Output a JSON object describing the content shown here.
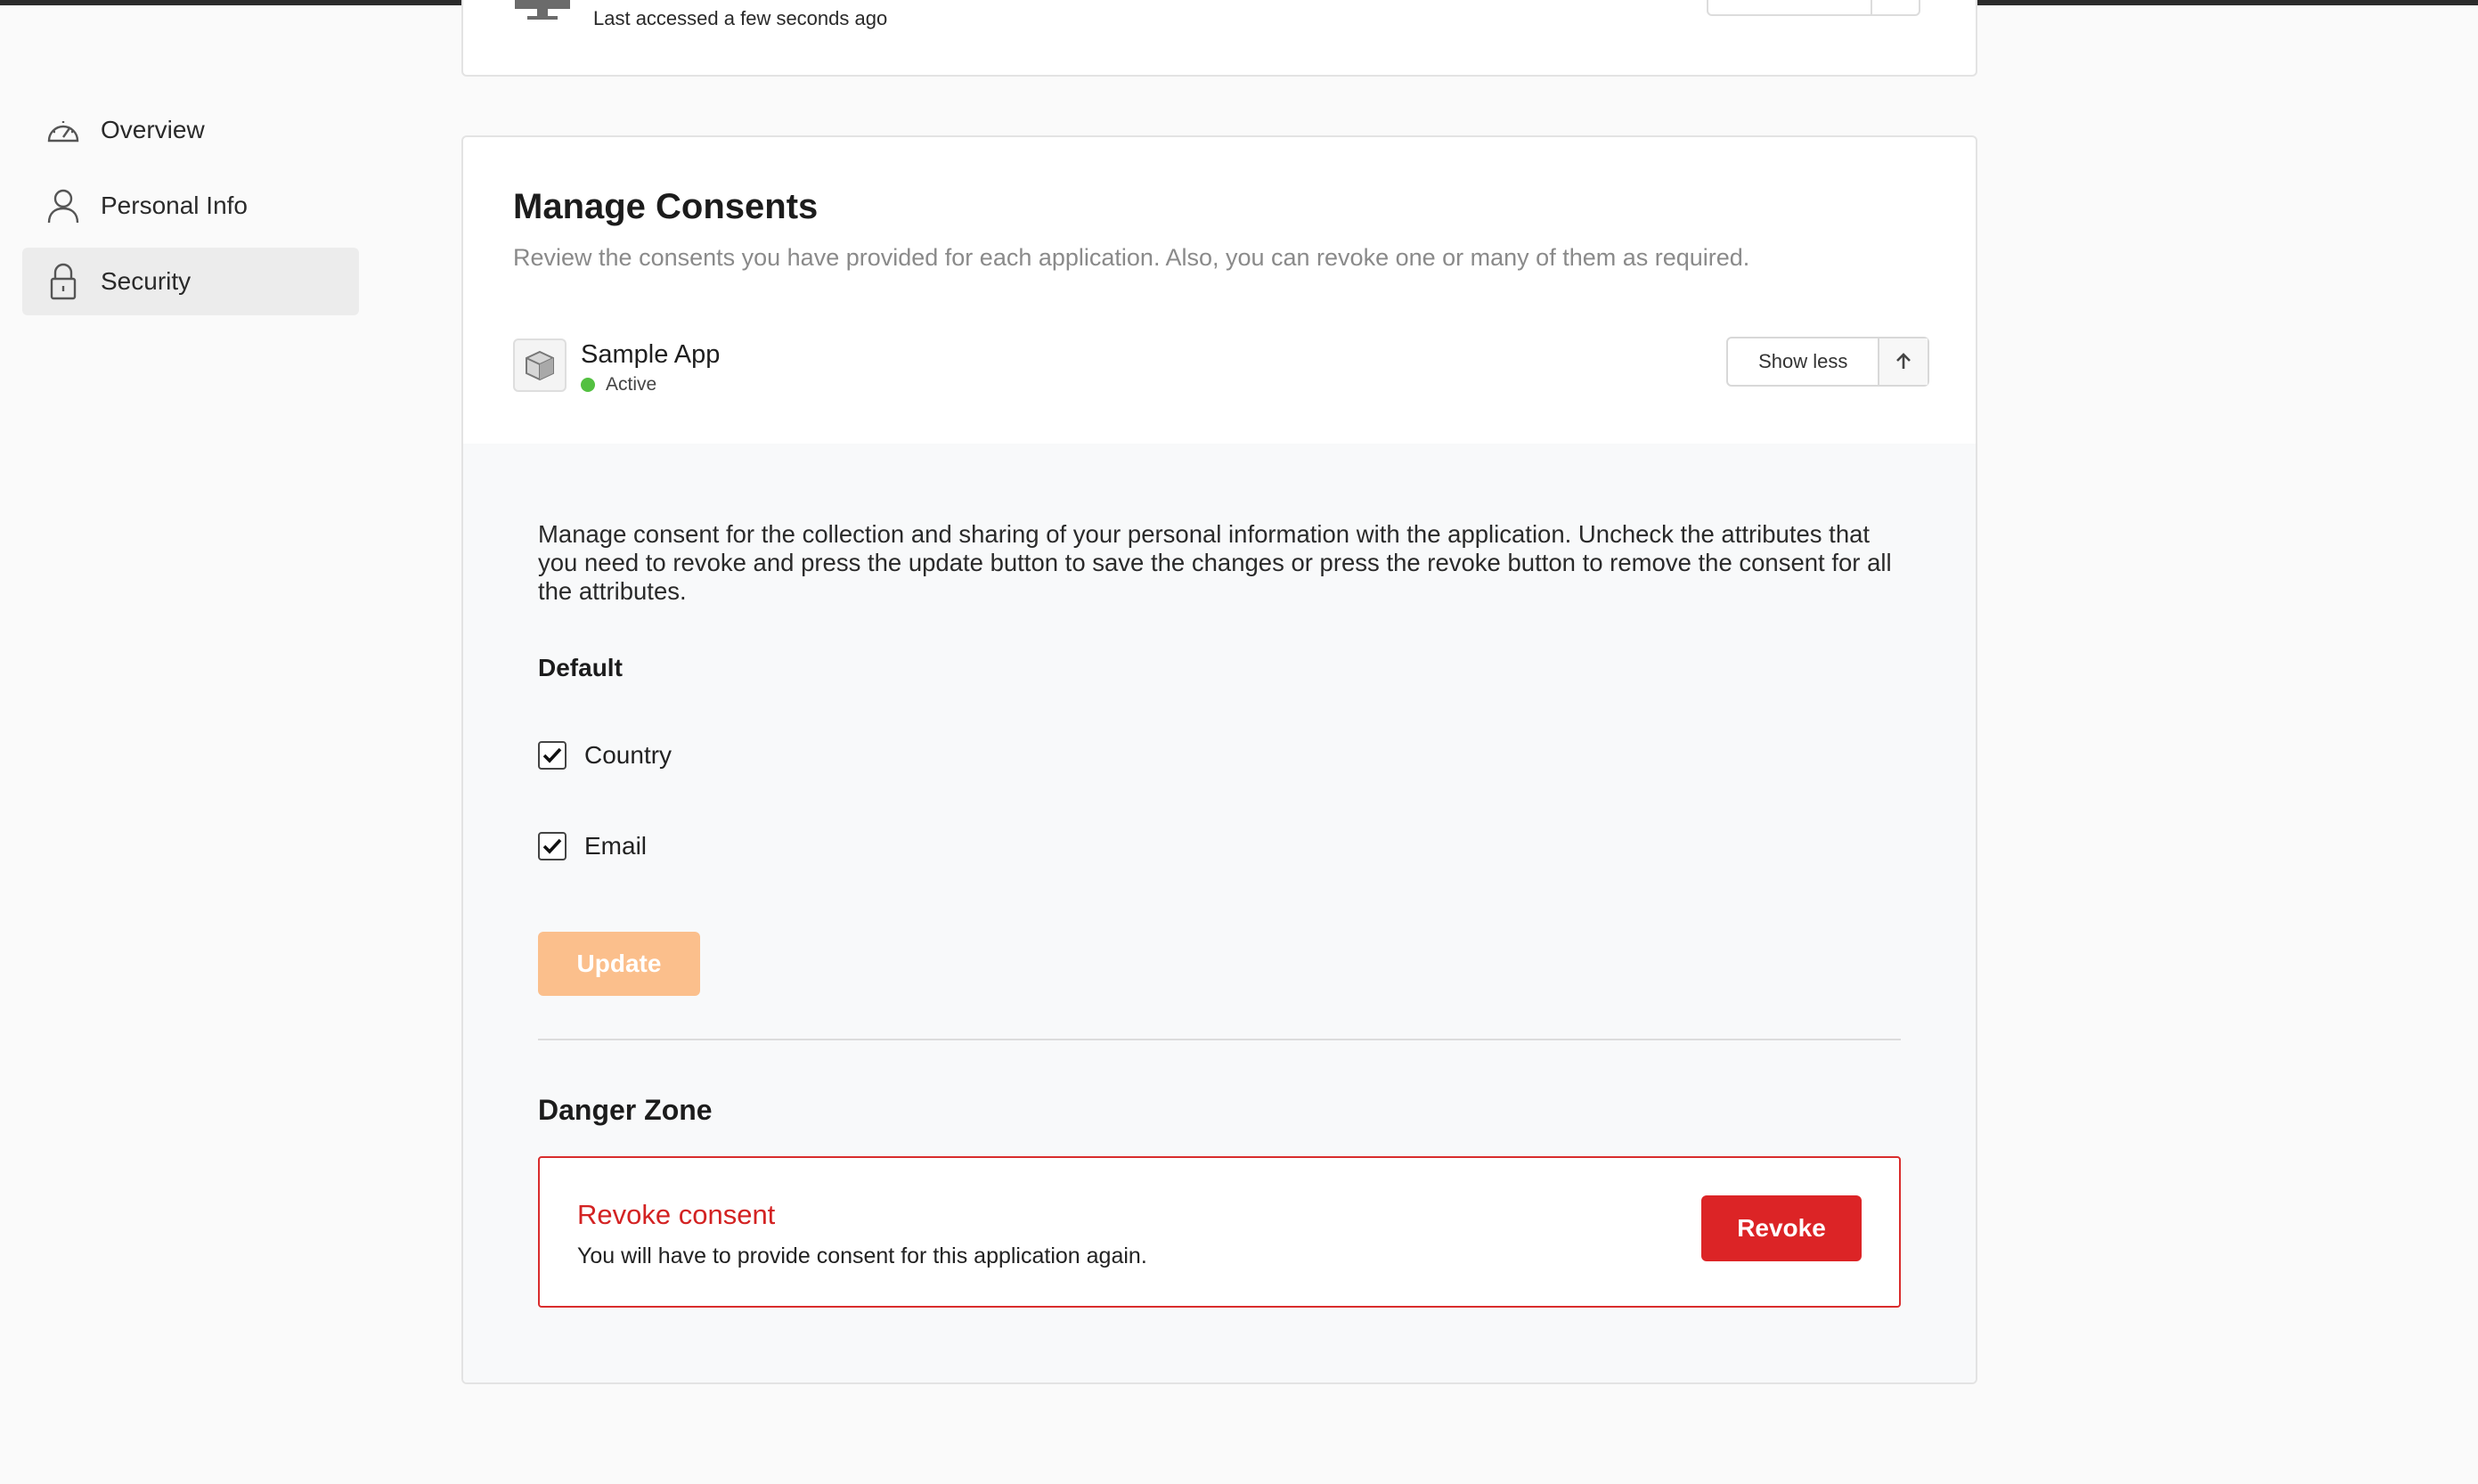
{
  "sidebar": {
    "items": [
      {
        "label": "Overview",
        "icon": "gauge-icon",
        "active": false
      },
      {
        "label": "Personal Info",
        "icon": "user-icon",
        "active": false
      },
      {
        "label": "Security",
        "icon": "lock-icon",
        "active": true
      }
    ]
  },
  "session_card": {
    "last_accessed": "Last accessed a few seconds ago",
    "icon": "monitor-icon"
  },
  "consents": {
    "title": "Manage Consents",
    "subtitle": "Review the consents you have provided for each application. Also, you can revoke one or many of them as required.",
    "app": {
      "name": "Sample App",
      "status": "Active",
      "status_color": "#53c041",
      "toggle_label": "Show less",
      "icon": "box-icon"
    },
    "description": "Manage consent for the collection and sharing of your personal information with the application. Uncheck the attributes that you need to revoke and press the update button to save the changes or press the revoke button to remove the consent for all the attributes.",
    "group_heading": "Default",
    "attributes": [
      {
        "label": "Country",
        "checked": true
      },
      {
        "label": "Email",
        "checked": true
      }
    ],
    "update_label": "Update",
    "update_color": "#fbbf8c",
    "danger_zone": {
      "heading": "Danger Zone",
      "title": "Revoke consent",
      "subtitle": "You will have to provide consent for this application again.",
      "button_label": "Revoke",
      "accent": "#dc2426"
    }
  }
}
